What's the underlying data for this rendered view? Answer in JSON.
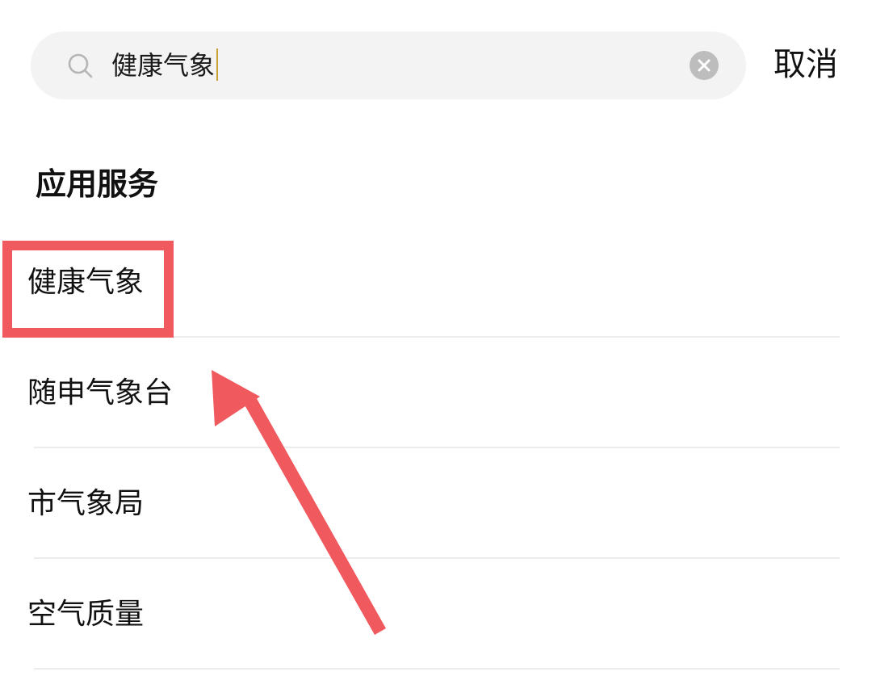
{
  "search": {
    "query": "健康气象",
    "cancel_label": "取消",
    "icon": "search-icon",
    "clear_icon": "clear-icon"
  },
  "section": {
    "title": "应用服务"
  },
  "results": [
    {
      "label": "健康气象"
    },
    {
      "label": "随申气象台"
    },
    {
      "label": "市气象局"
    },
    {
      "label": "空气质量"
    }
  ],
  "annotation": {
    "highlight_color": "#f05a5f",
    "arrow_color": "#f05a5f"
  },
  "colors": {
    "search_bg": "#f3f3f3",
    "caret": "#c9a23a",
    "divider": "#ececec"
  }
}
